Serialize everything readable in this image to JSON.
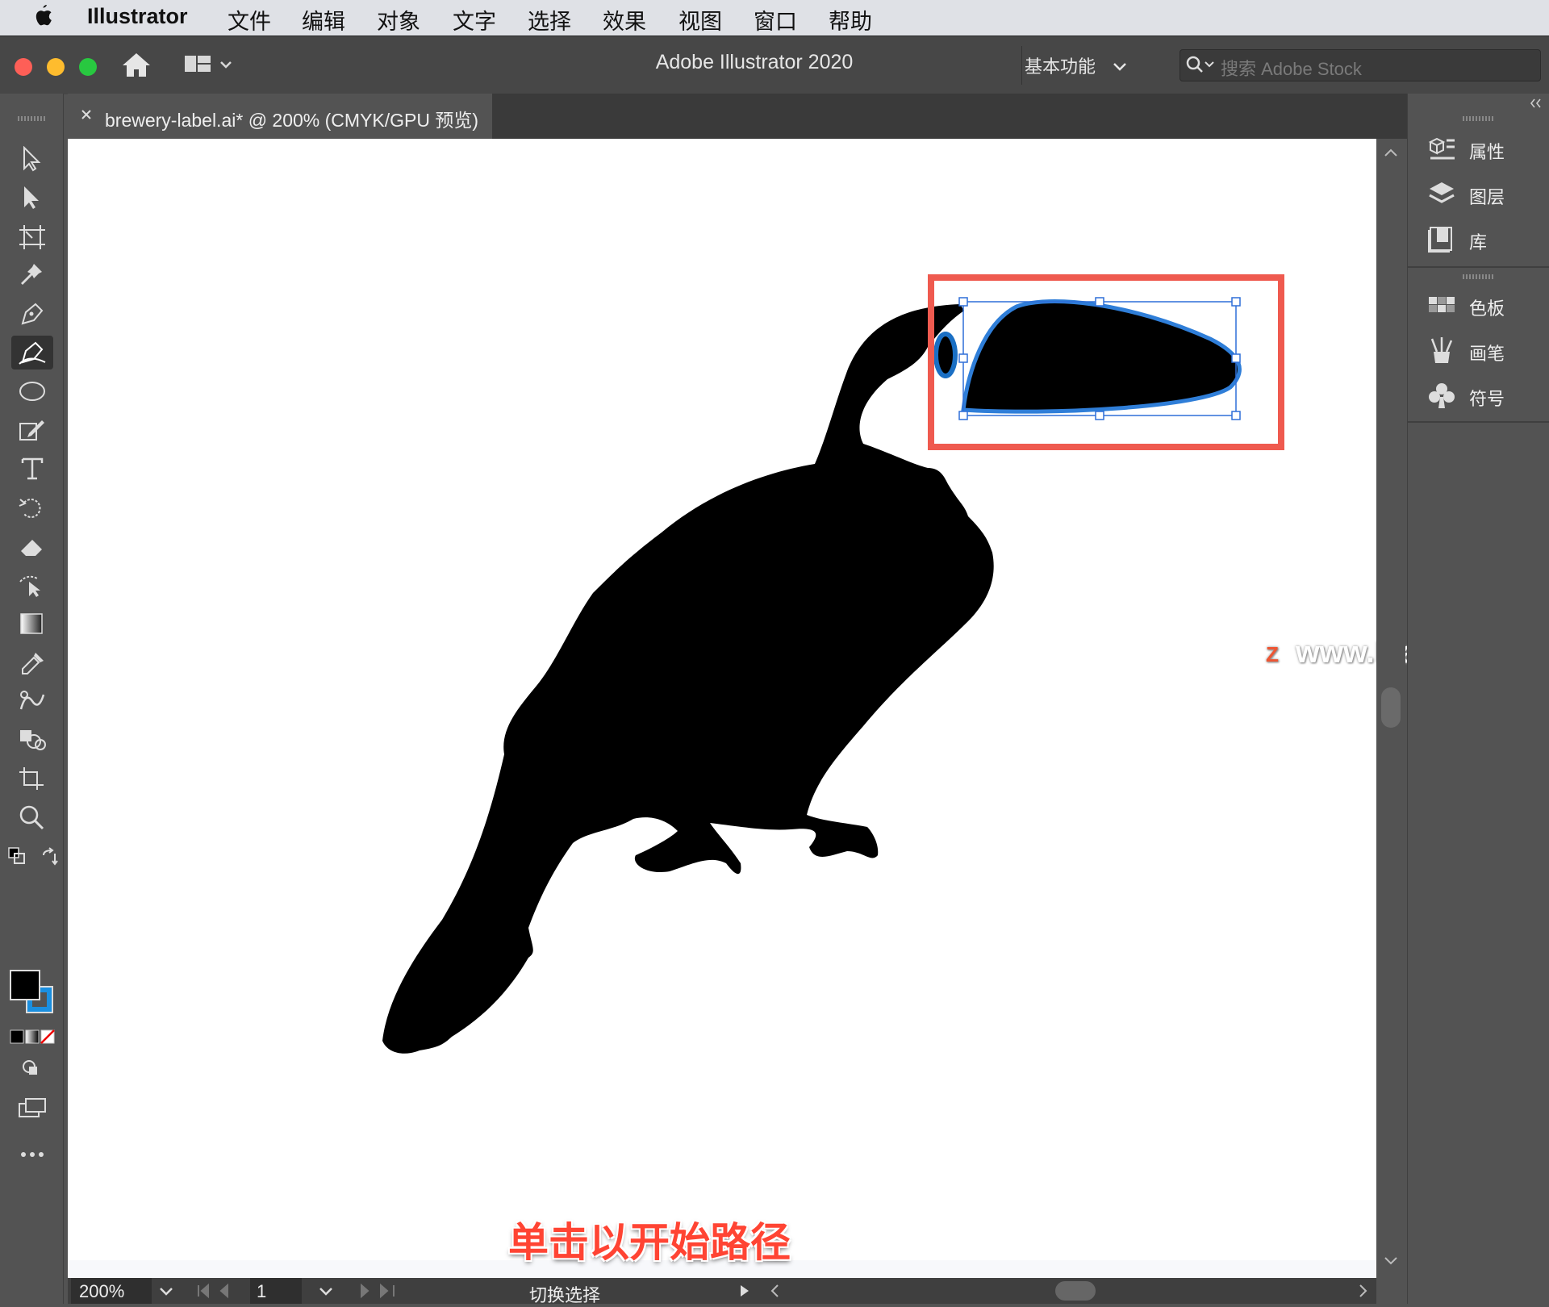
{
  "menubar": {
    "app_name": "Illustrator",
    "items": [
      "文件",
      "编辑",
      "对象",
      "文字",
      "选择",
      "效果",
      "视图",
      "窗口",
      "帮助"
    ]
  },
  "titlebar": {
    "title": "Adobe Illustrator 2020",
    "workspace": "基本功能",
    "search_placeholder": "搜索 Adobe Stock"
  },
  "document": {
    "tab_label": "brewery-label.ai* @ 200% (CMYK/GPU 预览)"
  },
  "right_panel": {
    "items": [
      "属性",
      "图层",
      "库",
      "色板",
      "画笔",
      "符号"
    ]
  },
  "statusbar": {
    "zoom": "200%",
    "page": "1",
    "status_text": "切换选择"
  },
  "overlay": {
    "watermark": "www.MacZ.com",
    "watermark_badge": "Z",
    "caption": "单击以开始路径"
  },
  "colors": {
    "highlight_box": "#ef5a4f",
    "path_stroke": "#2f7ed8",
    "caption": "#ff4433"
  }
}
